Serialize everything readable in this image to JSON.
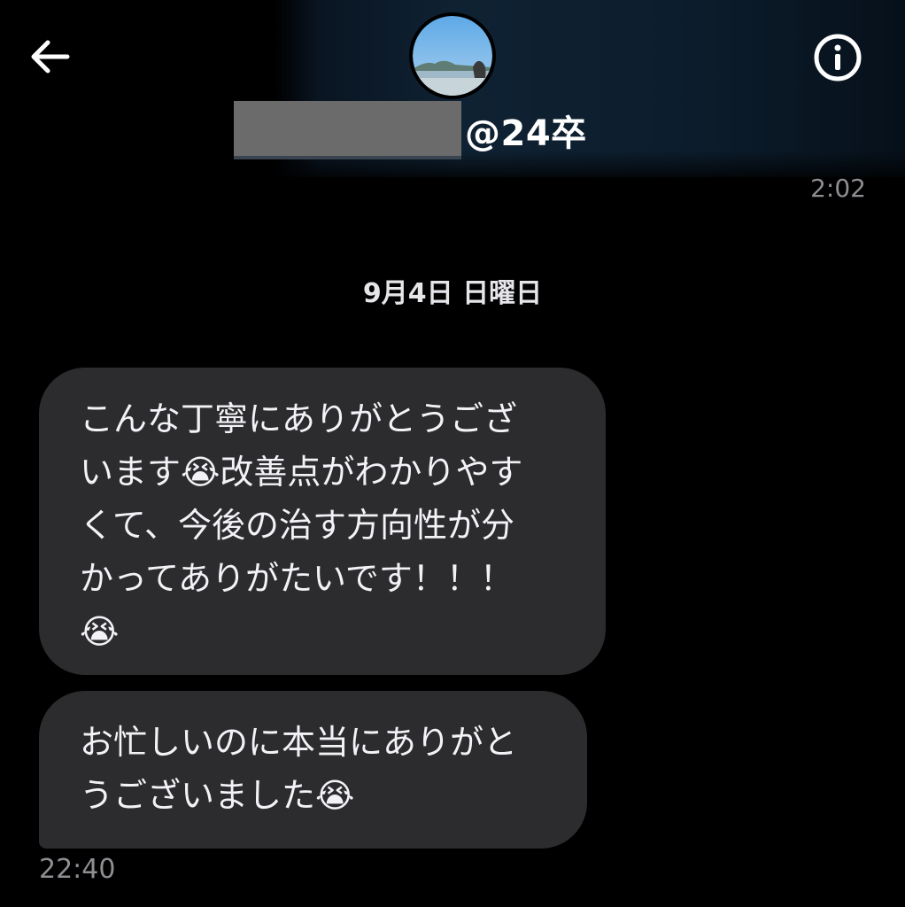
{
  "header": {
    "back_icon": "arrow-left-icon",
    "info_icon": "info-circle-icon",
    "handle_suffix": "@24卒",
    "name_redacted": true
  },
  "messages": {
    "first_timestamp": "2:02",
    "date_separator": "9月4日 日曜日",
    "bubble1_lines": [
      "こんな丁寧にありがとうござ",
      "います😭改善点がわかりやす",
      "くて、今後の治す方向性が分",
      "かってありがたいです！！！",
      "😭"
    ],
    "bubble2_lines": [
      "お忙しいのに本当にありがと",
      "うございました😭"
    ],
    "last_timestamp": "22:40"
  },
  "colors": {
    "background": "#000000",
    "bubble": "#2c2c2e",
    "timestamp": "#8e8e93"
  }
}
